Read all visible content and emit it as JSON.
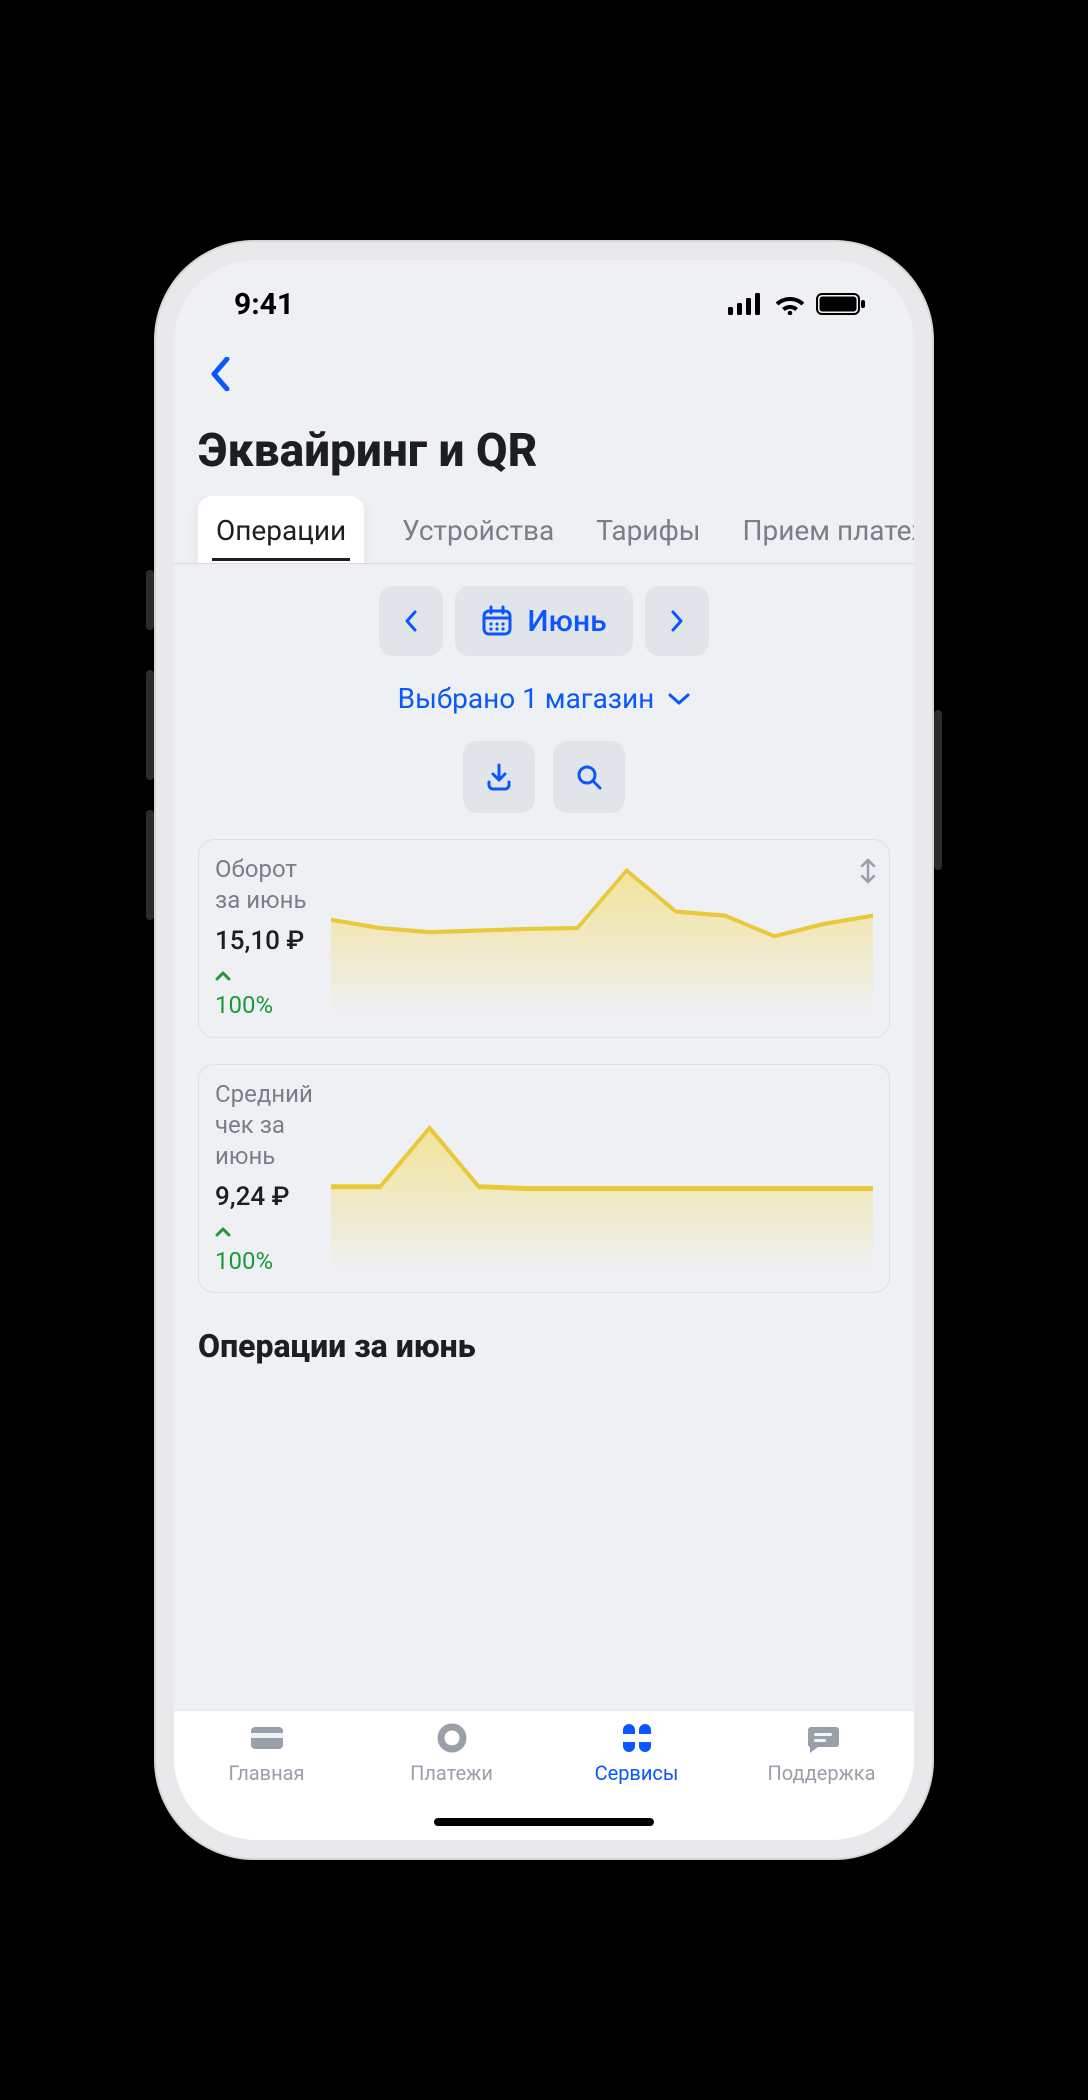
{
  "status": {
    "time": "9:41"
  },
  "page_title": "Эквайринг и QR",
  "tabs": [
    {
      "label": "Операции",
      "active": true
    },
    {
      "label": "Устройства",
      "active": false
    },
    {
      "label": "Тарифы",
      "active": false
    },
    {
      "label": "Прием платежей",
      "active": false
    }
  ],
  "month_picker": {
    "month": "Июнь"
  },
  "store_select": {
    "text": "Выбрано 1 магазин"
  },
  "cards": {
    "turnover": {
      "label": "Оборот за июнь",
      "value": "15,10 ₽",
      "trend_dir": "up",
      "trend_pct": "100%"
    },
    "avg_check": {
      "label": "Средний чек за июнь",
      "value": "9,24 ₽",
      "trend_dir": "up",
      "trend_pct": "100%"
    }
  },
  "section_title": "Операции за июнь",
  "bottom_nav": {
    "home": "Главная",
    "payments": "Платежи",
    "services": "Сервисы",
    "support": "Поддержка"
  },
  "chart_data": [
    {
      "type": "area",
      "title": "Оборот за июнь",
      "ylim": [
        0,
        20
      ],
      "points": [
        12,
        11,
        10.5,
        10.7,
        10.9,
        11,
        18,
        13,
        12.5,
        10,
        11.5,
        12.5
      ]
    },
    {
      "type": "area",
      "title": "Средний чек за июнь",
      "ylim": [
        0,
        20
      ],
      "points": [
        9,
        9,
        15,
        9,
        8.8,
        8.8,
        8.8,
        8.8,
        8.8,
        8.8,
        8.8,
        8.8
      ]
    }
  ]
}
